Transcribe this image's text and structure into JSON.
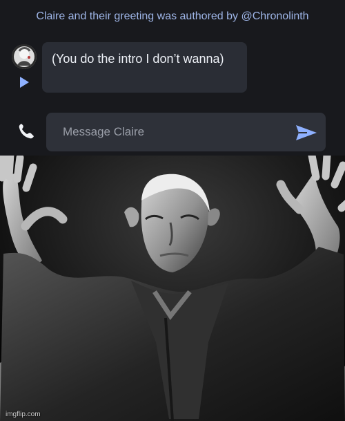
{
  "chat": {
    "attribution": "Claire and their greeting was authored by @Chronolinth",
    "message_text": "(You do the intro I don’t wanna)",
    "input_placeholder": "Message Claire"
  },
  "icons": {
    "avatar": "avatar",
    "play": "play-icon",
    "phone": "phone-icon",
    "send": "send-icon"
  },
  "colors": {
    "background": "#18191d",
    "bubble": "#2a2d35",
    "input": "#2e3139",
    "accent": "#8fb1ff"
  },
  "photo": {
    "watermark": "imgflip.com"
  }
}
